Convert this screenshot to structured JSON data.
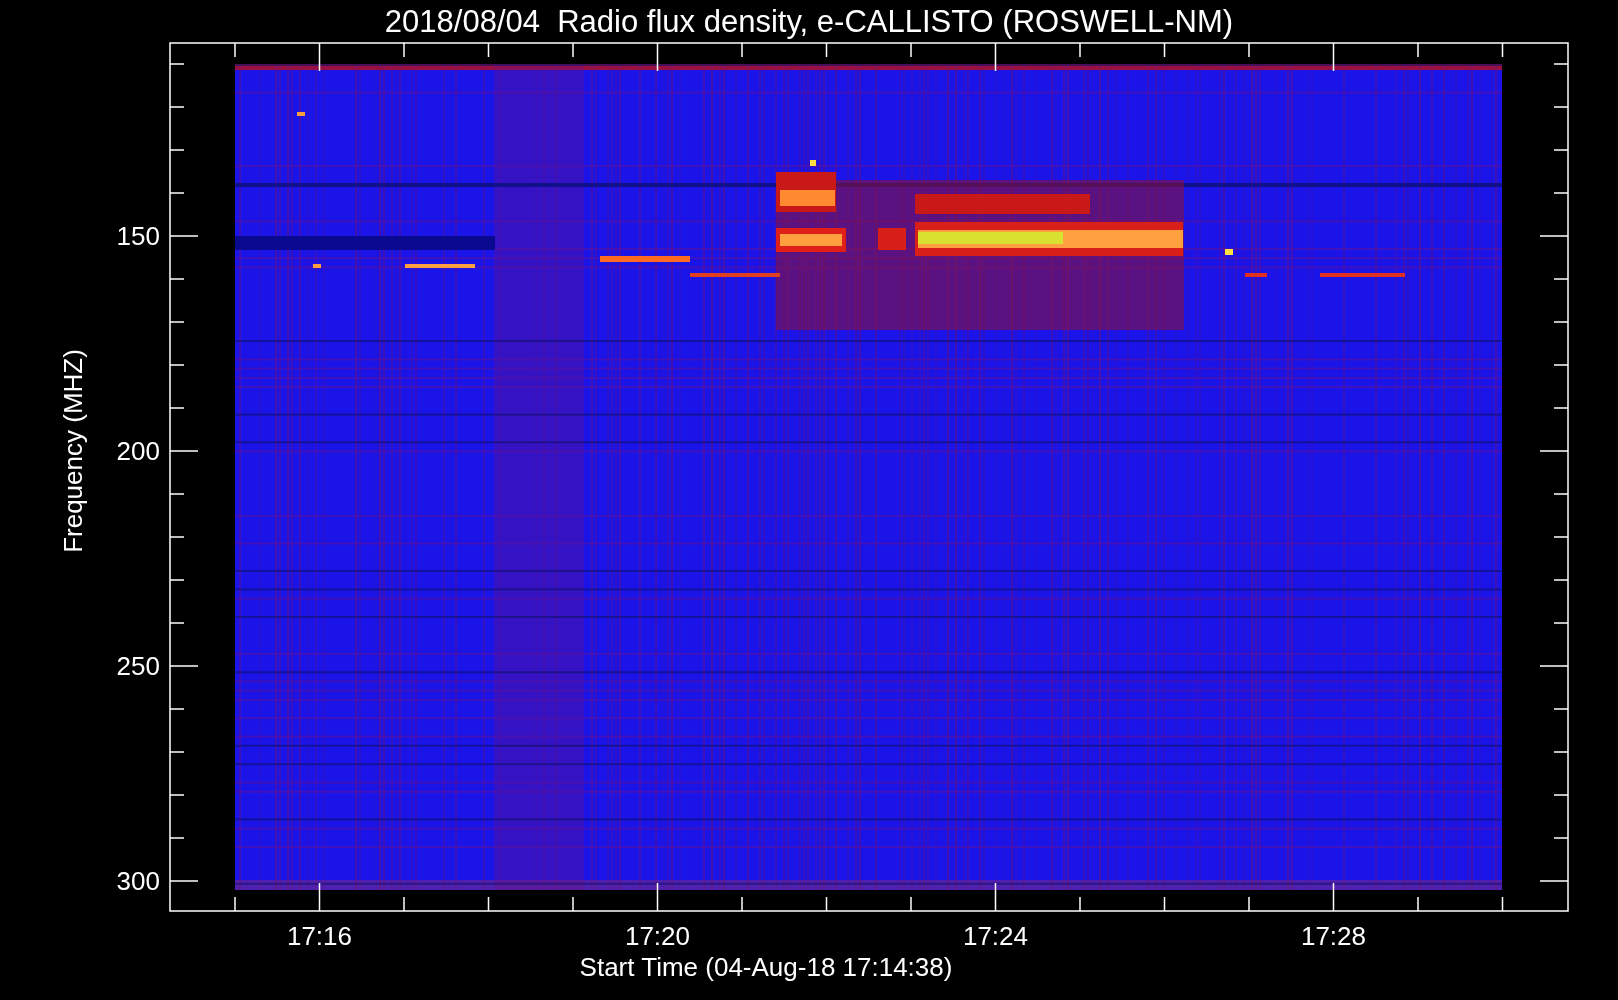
{
  "plot": {
    "title": "2018/08/04  Radio flux density, e-CALLISTO (ROSWELL-NM)",
    "ylabel": "Frequency (MHZ)",
    "xlabel": "Start Time (04-Aug-18 17:14:38)",
    "y_tick_labels": [
      "150",
      "200",
      "250",
      "300"
    ],
    "x_tick_labels": [
      "17:16",
      "17:20",
      "17:24",
      "17:28"
    ]
  }
}
